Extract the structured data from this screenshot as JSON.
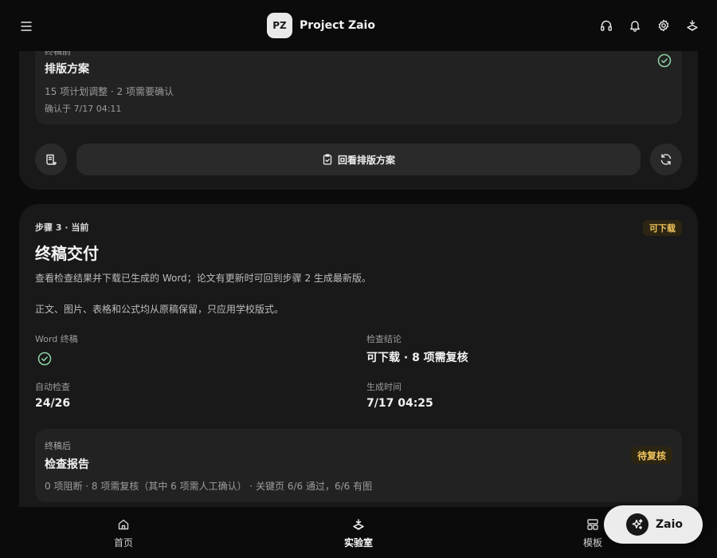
{
  "header": {
    "avatar_initials": "PZ",
    "project_name": "Project Zaio",
    "icons": [
      "menu-icon",
      "headphones-icon",
      "bell-icon",
      "gear-icon",
      "lab-icon"
    ]
  },
  "plan_card": {
    "eyebrow": "终稿前",
    "title": "排版方案",
    "summary": "15 项计划调整 · 2 项需要确认",
    "confirmed": "确认于 7/17 04:11",
    "review_button": "回看排版方案"
  },
  "step_card": {
    "step_tag": "步骤 3 · 当前",
    "badge": "可下载",
    "title": "终稿交付",
    "description": "查看检查结果并下载已生成的 Word；论文有更新时可回到步骤 2 生成最新版。",
    "note": "正文、图片、表格和公式均从原稿保留，只应用学校版式。",
    "stats": {
      "word_label": "Word 终稿",
      "conclusion_label": "检查结论",
      "conclusion_value": "可下载 · 8 项需复核",
      "auto_label": "自动检查",
      "auto_value": "24/26",
      "time_label": "生成时间",
      "time_value": "7/17 04:25"
    },
    "report": {
      "eyebrow": "终稿后",
      "title": "检查报告",
      "badge": "待复核",
      "summary": "0 项阻断 · 8 项需复核（其中 6 项需人工确认） · 关键页 6/6 通过，6/6 有图"
    }
  },
  "bottom_nav": {
    "items": [
      {
        "label": "首页",
        "icon": "home-icon"
      },
      {
        "label": "实验室",
        "icon": "lab-icon",
        "active": true
      },
      {
        "label": "模板",
        "icon": "template-icon"
      }
    ],
    "assistant_label": "Zaio"
  },
  "colors": {
    "background": "#0b0b0b",
    "card": "#191919",
    "inner_card": "#222222",
    "badge_text": "#f0c35c",
    "success_green": "#8fd3a6"
  }
}
